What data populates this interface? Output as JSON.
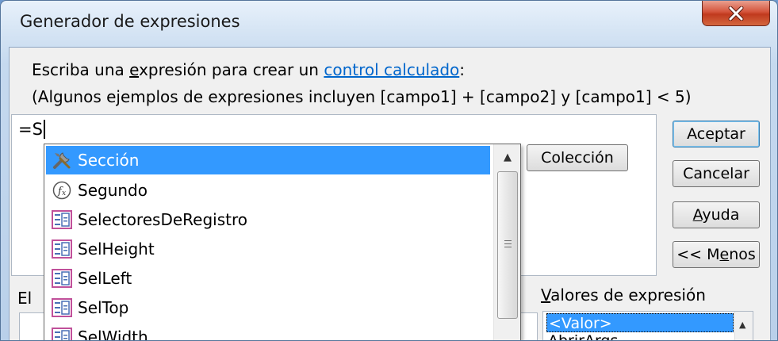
{
  "window": {
    "title": "Generador de expresiones",
    "close_icon": "close-icon"
  },
  "prompt": {
    "line1_prefix": "Escriba una ",
    "line1_ul": "e",
    "line1_mid": "xpresión para crear un ",
    "line1_link": "control calculado",
    "line1_suffix": ":",
    "line2": "(Algunos ejemplos de expresiones incluyen [campo1] + [campo2] y [campo1] < 5)"
  },
  "expression": {
    "value": "=S"
  },
  "buttons": {
    "ok": "Aceptar",
    "cancel": "Cancelar",
    "help_ul": "A",
    "help_rest": "yuda",
    "less_pre": "<< M",
    "less_ul": "e",
    "less_post": "nos",
    "collection": "Colección"
  },
  "labels": {
    "elements_partial": "El",
    "values_ul": "V",
    "values_rest": "alores de expresión"
  },
  "autocomplete": {
    "items": [
      {
        "label": "Sección",
        "icon": "tools-icon",
        "selected": true
      },
      {
        "label": "Segundo",
        "icon": "function-icon",
        "selected": false
      },
      {
        "label": "SelectoresDeRegistro",
        "icon": "property-icon",
        "selected": false
      },
      {
        "label": "SelHeight",
        "icon": "property-icon",
        "selected": false
      },
      {
        "label": "SelLeft",
        "icon": "property-icon",
        "selected": false
      },
      {
        "label": "SelTop",
        "icon": "property-icon",
        "selected": false
      },
      {
        "label": "SelWidth",
        "icon": "property-icon",
        "selected": false
      }
    ]
  },
  "values_list": {
    "selected": "<Valor>",
    "next": "AbrirArgs"
  },
  "colors": {
    "selection": "#3399ff",
    "link": "#0066cc",
    "close": "#c8452b"
  }
}
